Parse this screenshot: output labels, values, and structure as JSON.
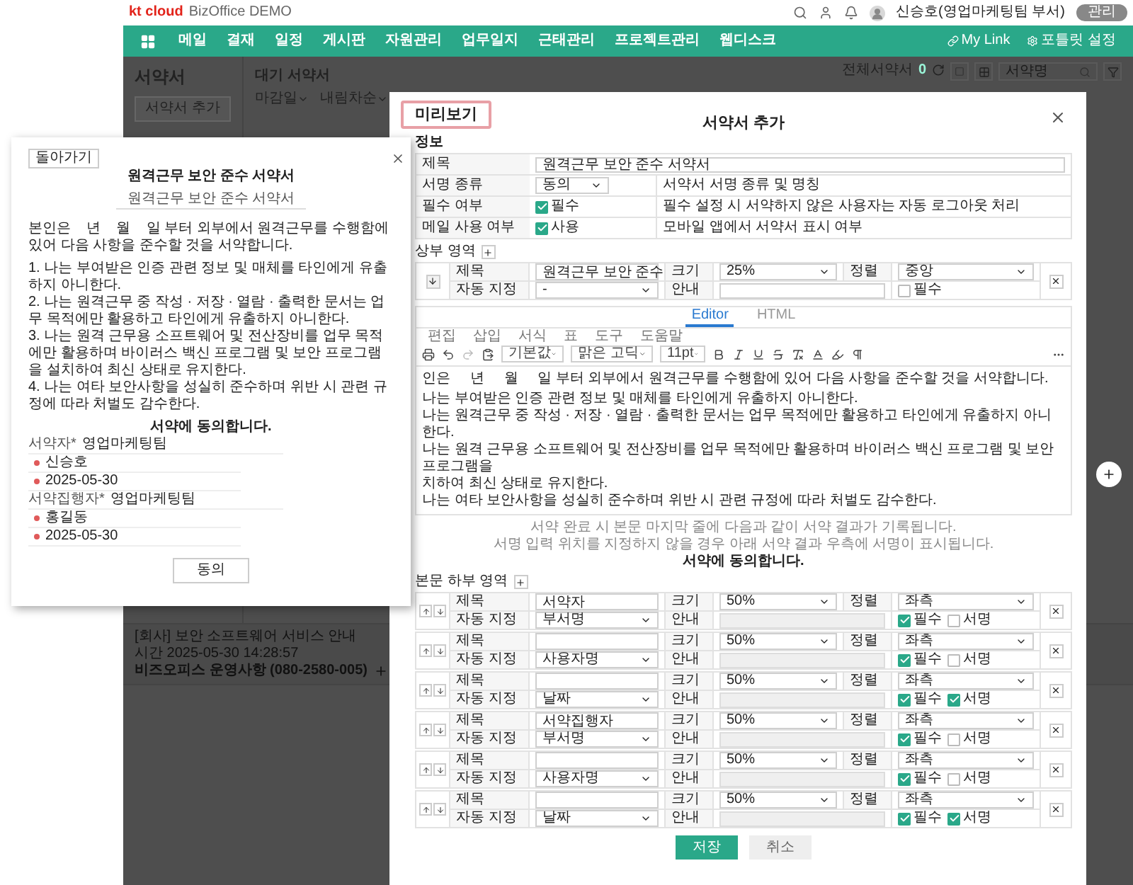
{
  "header": {
    "logo": "kt cloud",
    "logo_sub": "BizOffice DEMO",
    "user": "신승호(영업마케팅팀 부서)",
    "admin_button": "관리"
  },
  "nav": {
    "items": [
      "메일",
      "결재",
      "일정",
      "게시판",
      "자원관리",
      "업무일지",
      "근태관리",
      "프로젝트관리",
      "웹디스크"
    ],
    "my_link": "My Link",
    "portlet": "포틀릿 설정"
  },
  "sidebar": {
    "title": "서약서",
    "add_button": "서약서 추가"
  },
  "list": {
    "title": "대기 서약서",
    "sorts": [
      "마감일",
      "내림차순"
    ],
    "search": {
      "placeholder": "서약명"
    },
    "count_label": "전체서약서",
    "count": "0"
  },
  "status_bar": {
    "notice": "[회사] 보안 소프트웨어 서비스 안내",
    "time": "시간 2025-05-30 14:28:57",
    "contact": "비즈오피스 운영사항 (080-2580-005)"
  },
  "preview": {
    "back_button": "돌아가기",
    "title": "원격근무 보안 준수 서약서",
    "subtitle": "원격근무 보안 준수 서약서",
    "intro": "본인은    년    월    일 부터 외부에서 원격근무를 수행함에 있어 다음 사항을 준수할 것을 서약합니다.",
    "items": [
      "1. 나는 부여받은 인증 관련 정보 및 매체를 타인에게 유출하지 아니한다.",
      "2. 나는 원격근무 중 작성 · 저장 · 열람 · 출력한 문서는 업무 목적에만 활용하고 타인에게 유출하지 아니한다.",
      "3. 나는 원격 근무용 소프트웨어 및 전산장비를 업무 목적에만 활용하며 바이러스 백신 프로그램 및 보안 프로그램을 설치하여 최신 상태로 유지한다.",
      "4. 나는 여타 보안사항을 성실히 준수하며 위반 시 관련 규정에 따라 처벌도 감수한다."
    ],
    "agree": "서약에 동의합니다.",
    "signers": [
      {
        "label": "서약자*",
        "dept": "영업마케팅팀",
        "name": "신승호",
        "date": "2025-05-30"
      },
      {
        "label": "서약집행자*",
        "dept": "영업마케팅팀",
        "name": "홍길동",
        "date": "2025-05-30"
      }
    ],
    "agree_button": "동의"
  },
  "modal": {
    "preview_tab": "미리보기",
    "title": "서약서 추가",
    "section": "정보",
    "info_rows": [
      {
        "label": "제목",
        "kind": "input",
        "value": "원격근무 보안 준수 서약서"
      },
      {
        "label": "서명 종류",
        "kind": "select",
        "value": "동의",
        "note": "서약서 서명 종류 및 명칭"
      },
      {
        "label": "필수 여부",
        "kind": "checkbox",
        "checked": true,
        "value": "필수",
        "note": "필수 설정 시 서약하지 않은 사용자는 자동 로그아웃 처리"
      },
      {
        "label": "메일 사용 여부",
        "kind": "checkbox",
        "checked": true,
        "value": "사용",
        "note": "모바일 앱에서 서약서 표시 여부"
      }
    ],
    "upper": {
      "label": "상부 영역",
      "rows": [
        {
          "kind": "upper",
          "labels": [
            "제목",
            "크기",
            "정렬",
            "자동 지정",
            "안내"
          ],
          "title": "원격근무 보안 준수",
          "size": "25%",
          "align": "중앙",
          "auto": "-",
          "disabled": false,
          "checks": [
            {
              "label": "필수",
              "checked": false
            }
          ]
        }
      ]
    },
    "editor": {
      "tabs": [
        {
          "label": "Editor",
          "selected": true
        },
        {
          "label": "HTML",
          "selected": false
        }
      ],
      "menus": [
        "편집",
        "삽입",
        "서식",
        "표",
        "도구",
        "도움말"
      ],
      "style": "기본값",
      "font": "맑은 고딕",
      "size": "11pt",
      "paragraphs": [
        "인은     년     월     일 부터 외부에서 원격근무를 수행함에 있어 다음 사항을 준수할 것을 서약합니다.",
        "나는 부여받은 인증 관련 정보 및 매체를 타인에게 유출하지 아니한다.",
        "나는 원격근무 중 작성 · 저장 · 열람 · 출력한 문서는 업무 목적에만 활용하고 타인에게 유출하지 아니한다.",
        "나는 원격 근무용 소프트웨어 및 전산장비를 업무 목적에만 활용하며 바이러스 백신 프로그램 및 보안 프로그램을",
        "치하여 최신 상태로 유지한다.",
        "나는 여타 보안사항을 성실히 준수하며 위반 시 관련 규정에 따라 처벌도 감수한다."
      ]
    },
    "notes": [
      "서약 완료 시 본문 마지막 줄에 다음과 같이 서약 결과가 기록됩니다.",
      "서명 입력 위치를 지정하지 않을 경우 아래 서약 결과 우측에 서명이 표시됩니다."
    ],
    "agree": "서약에 동의합니다.",
    "lower": {
      "label": "본문 하부 영역",
      "rows": [
        {
          "kind": "lower",
          "labels": [
            "제목",
            "크기",
            "정렬",
            "자동 지정",
            "안내"
          ],
          "title": "서약자",
          "size": "50%",
          "align": "좌측",
          "auto": "부서명",
          "disabled": true,
          "checks": [
            {
              "label": "필수",
              "checked": true
            },
            {
              "label": "서명",
              "checked": false
            }
          ]
        },
        {
          "kind": "lower",
          "labels": [
            "제목",
            "크기",
            "정렬",
            "자동 지정",
            "안내"
          ],
          "size": "50%",
          "align": "좌측",
          "auto": "사용자명",
          "disabled": true,
          "checks": [
            {
              "label": "필수",
              "checked": true
            },
            {
              "label": "서명",
              "checked": false
            }
          ]
        },
        {
          "kind": "lower",
          "labels": [
            "제목",
            "크기",
            "정렬",
            "자동 지정",
            "안내"
          ],
          "size": "50%",
          "align": "좌측",
          "auto": "날짜",
          "disabled": true,
          "checks": [
            {
              "label": "필수",
              "checked": true
            },
            {
              "label": "서명",
              "checked": true
            }
          ]
        },
        {
          "kind": "lower",
          "labels": [
            "제목",
            "크기",
            "정렬",
            "자동 지정",
            "안내"
          ],
          "title": "서약집행자",
          "size": "50%",
          "align": "좌측",
          "auto": "부서명",
          "disabled": true,
          "checks": [
            {
              "label": "필수",
              "checked": true
            },
            {
              "label": "서명",
              "checked": false
            }
          ]
        },
        {
          "kind": "lower",
          "labels": [
            "제목",
            "크기",
            "정렬",
            "자동 지정",
            "안내"
          ],
          "size": "50%",
          "align": "좌측",
          "auto": "사용자명",
          "disabled": true,
          "checks": [
            {
              "label": "필수",
              "checked": true
            },
            {
              "label": "서명",
              "checked": false
            }
          ]
        },
        {
          "kind": "lower",
          "labels": [
            "제목",
            "크기",
            "정렬",
            "자동 지정",
            "안내"
          ],
          "size": "50%",
          "align": "좌측",
          "auto": "날짜",
          "disabled": true,
          "checks": [
            {
              "label": "필수",
              "checked": true
            },
            {
              "label": "서명",
              "checked": true
            }
          ]
        }
      ]
    },
    "buttons": {
      "save": "저장",
      "cancel": "취소"
    }
  }
}
